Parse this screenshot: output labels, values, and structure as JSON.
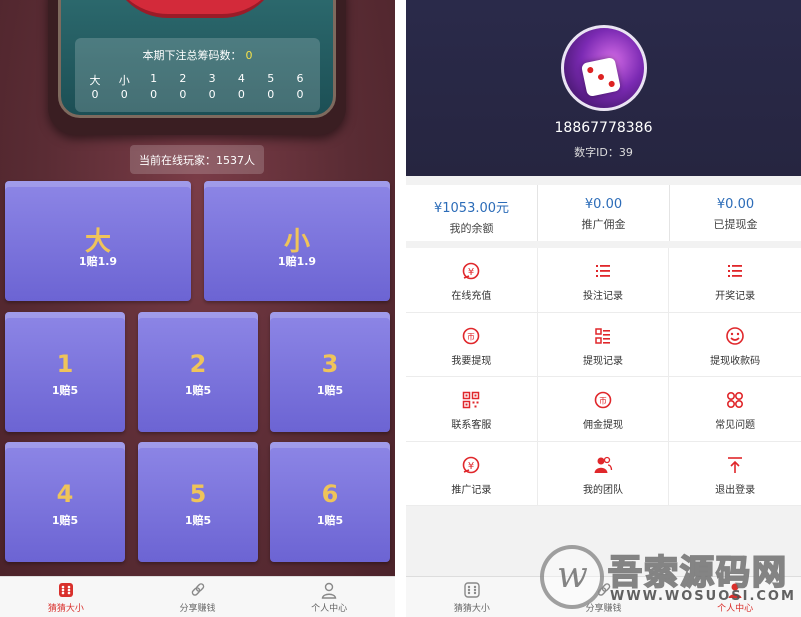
{
  "game": {
    "bet_total_label": "本期下注总筹码数：",
    "bet_total_value": "0",
    "bet_headers": [
      "大",
      "小",
      "1",
      "2",
      "3",
      "4",
      "5",
      "6"
    ],
    "bet_values": [
      "0",
      "0",
      "0",
      "0",
      "0",
      "0",
      "0",
      "0"
    ],
    "online_players": "当前在线玩家：1537人",
    "big": {
      "label": "大",
      "odds": "1赔1.9"
    },
    "small": {
      "label": "小",
      "odds": "1赔1.9"
    },
    "numbers": [
      {
        "label": "1",
        "odds": "1赔5"
      },
      {
        "label": "2",
        "odds": "1赔5"
      },
      {
        "label": "3",
        "odds": "1赔5"
      },
      {
        "label": "4",
        "odds": "1赔5"
      },
      {
        "label": "5",
        "odds": "1赔5"
      },
      {
        "label": "6",
        "odds": "1赔5"
      }
    ],
    "colors": {
      "cell": "#7b73dd",
      "big_text": "#efc45a",
      "background": "#5a2c34",
      "table": "#2f6e72"
    }
  },
  "tabbar": {
    "items": [
      {
        "label": "猜猜大小",
        "icon": "dice-icon",
        "active": true
      },
      {
        "label": "分享赚钱",
        "icon": "link-icon",
        "active": false
      },
      {
        "label": "个人中心",
        "icon": "user-icon",
        "active": false
      }
    ],
    "active_color": "#d9302c"
  },
  "profile": {
    "phone": "18867778386",
    "uid": "数字ID：39",
    "stats": [
      {
        "value": "¥1053.00元",
        "label": "我的余额"
      },
      {
        "value": "¥0.00",
        "label": "推广佣金"
      },
      {
        "value": "¥0.00",
        "label": "已提现金"
      }
    ],
    "menu": [
      {
        "label": "在线充值",
        "icon": "recharge-icon"
      },
      {
        "label": "投注记录",
        "icon": "list-icon"
      },
      {
        "label": "开奖记录",
        "icon": "list-icon"
      },
      {
        "label": "我要提现",
        "icon": "coin-icon"
      },
      {
        "label": "提现记录",
        "icon": "record-grid-icon"
      },
      {
        "label": "提现收款码",
        "icon": "smile-icon"
      },
      {
        "label": "联系客服",
        "icon": "qrcode-icon"
      },
      {
        "label": "佣金提现",
        "icon": "coin-icon"
      },
      {
        "label": "常见问题",
        "icon": "apps-icon"
      },
      {
        "label": "推广记录",
        "icon": "recharge-icon"
      },
      {
        "label": "我的团队",
        "icon": "team-icon"
      },
      {
        "label": "退出登录",
        "icon": "logout-icon"
      }
    ],
    "accent": "#e0272b",
    "header_color": "#27263f"
  },
  "watermark": {
    "cn": "吾索源码网",
    "en": "WWW.WOSUOSI.COM"
  }
}
